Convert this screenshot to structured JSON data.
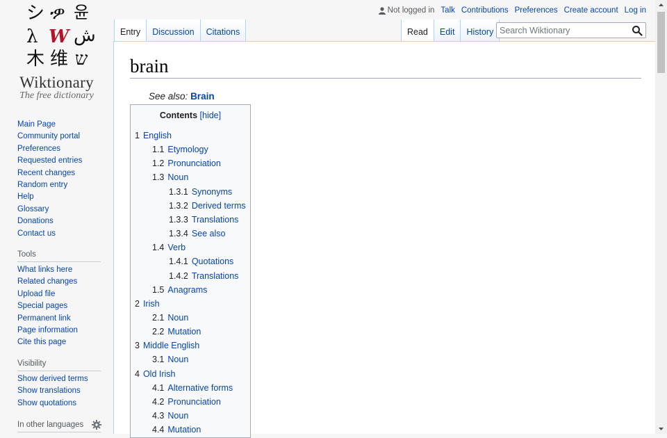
{
  "logo": {
    "wordmark": "Wiktionary",
    "tagline": "The free dictionary",
    "glyphs": [
      "シ",
      "ዏ",
      "윤",
      "λ",
      "W",
      "ش",
      "⽊",
      "维",
      "ש"
    ]
  },
  "personal_tools": {
    "status": "Not logged in",
    "links": [
      "Talk",
      "Contributions",
      "Preferences",
      "Create account",
      "Log in"
    ]
  },
  "tabs": {
    "left": [
      "Entry",
      "Discussion",
      "Citations"
    ],
    "right": [
      "Read",
      "Edit",
      "History"
    ],
    "selected_left": "Entry",
    "selected_right": "Read"
  },
  "search": {
    "placeholder": "Search Wiktionary",
    "value": ""
  },
  "page": {
    "title": "brain",
    "see_also_label": "See also:",
    "see_also_link": "Brain"
  },
  "toc": {
    "title": "Contents",
    "hide_label": "[hide]",
    "items": [
      {
        "num": "1",
        "label": "English",
        "level": 1
      },
      {
        "num": "1.1",
        "label": "Etymology",
        "level": 2
      },
      {
        "num": "1.2",
        "label": "Pronunciation",
        "level": 2
      },
      {
        "num": "1.3",
        "label": "Noun",
        "level": 2
      },
      {
        "num": "1.3.1",
        "label": "Synonyms",
        "level": 3
      },
      {
        "num": "1.3.2",
        "label": "Derived terms",
        "level": 3
      },
      {
        "num": "1.3.3",
        "label": "Translations",
        "level": 3
      },
      {
        "num": "1.3.4",
        "label": "See also",
        "level": 3
      },
      {
        "num": "1.4",
        "label": "Verb",
        "level": 2
      },
      {
        "num": "1.4.1",
        "label": "Quotations",
        "level": 3
      },
      {
        "num": "1.4.2",
        "label": "Translations",
        "level": 3
      },
      {
        "num": "1.5",
        "label": "Anagrams",
        "level": 2
      },
      {
        "num": "2",
        "label": "Irish",
        "level": 1
      },
      {
        "num": "2.1",
        "label": "Noun",
        "level": 2
      },
      {
        "num": "2.2",
        "label": "Mutation",
        "level": 2
      },
      {
        "num": "3",
        "label": "Middle English",
        "level": 1
      },
      {
        "num": "3.1",
        "label": "Noun",
        "level": 2
      },
      {
        "num": "4",
        "label": "Old Irish",
        "level": 1
      },
      {
        "num": "4.1",
        "label": "Alternative forms",
        "level": 2
      },
      {
        "num": "4.2",
        "label": "Pronunciation",
        "level": 2
      },
      {
        "num": "4.3",
        "label": "Noun",
        "level": 2
      },
      {
        "num": "4.4",
        "label": "Mutation",
        "level": 2
      }
    ]
  },
  "sidebar": {
    "navigation": [
      "Main Page",
      "Community portal",
      "Preferences",
      "Requested entries",
      "Recent changes",
      "Random entry",
      "Help",
      "Glossary",
      "Donations",
      "Contact us"
    ],
    "tools_heading": "Tools",
    "tools": [
      "What links here",
      "Related changes",
      "Upload file",
      "Special pages",
      "Permanent link",
      "Page information",
      "Cite this page"
    ],
    "visibility_heading": "Visibility",
    "visibility": [
      "Show derived terms",
      "Show translations",
      "Show quotations"
    ],
    "languages_heading": "In other languages"
  },
  "colors": {
    "link": "#0645ad",
    "tab_border": "#a7d7f9",
    "sidebar_bg": "#f6f6f6"
  }
}
